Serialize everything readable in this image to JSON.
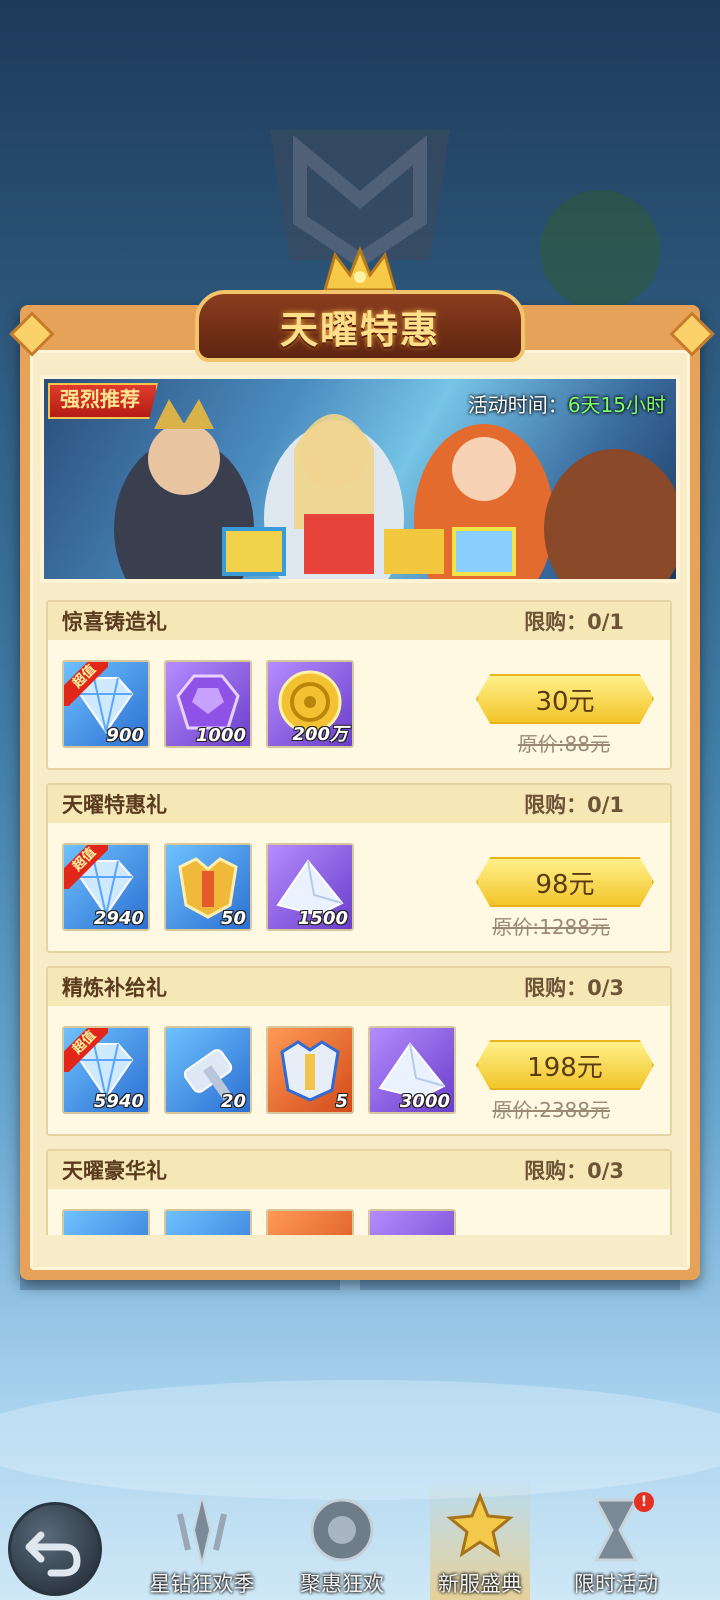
{
  "title": "天曜特惠",
  "banner": {
    "tag": "强烈推荐",
    "time_label": "活动时间：",
    "time_value": "6天15小时"
  },
  "packs": [
    {
      "name": "惊喜铸造礼",
      "limit": "限购：0/1",
      "price": "30元",
      "original": "原价:88元",
      "items": [
        {
          "icon": "diamond-icon",
          "qty": "900",
          "hot": "超值"
        },
        {
          "icon": "purple-crystal-icon",
          "qty": "1000"
        },
        {
          "icon": "gold-coin-icon",
          "qty": "200万"
        }
      ]
    },
    {
      "name": "天曜特惠礼",
      "limit": "限购：0/1",
      "price": "98元",
      "original": "原价:1288元",
      "items": [
        {
          "icon": "diamond-icon",
          "qty": "2940",
          "hot": "超值"
        },
        {
          "icon": "golden-armor-icon",
          "qty": "50"
        },
        {
          "icon": "silver-ore-icon",
          "qty": "1500"
        }
      ]
    },
    {
      "name": "精炼补给礼",
      "limit": "限购：0/3",
      "price": "198元",
      "original": "原价:2388元",
      "items": [
        {
          "icon": "diamond-icon",
          "qty": "5940",
          "hot": "超值"
        },
        {
          "icon": "hammer-icon",
          "qty": "20"
        },
        {
          "icon": "armor-icon",
          "qty": "5"
        },
        {
          "icon": "silver-ore-icon",
          "qty": "3000"
        }
      ]
    },
    {
      "name": "天曜豪华礼",
      "limit": "限购：0/3"
    }
  ],
  "nav": [
    {
      "label": "星钻狂欢季",
      "icon": "star-drill-icon"
    },
    {
      "label": "聚惠狂欢",
      "icon": "discount-icon"
    },
    {
      "label": "新服盛典",
      "icon": "trophy-star-icon"
    },
    {
      "label": "限时活动",
      "icon": "hourglass-icon",
      "badge": "!"
    }
  ],
  "colors": {
    "accent": "#f2c52a",
    "frame": "#e7a25a",
    "timer": "#7cff6b"
  }
}
